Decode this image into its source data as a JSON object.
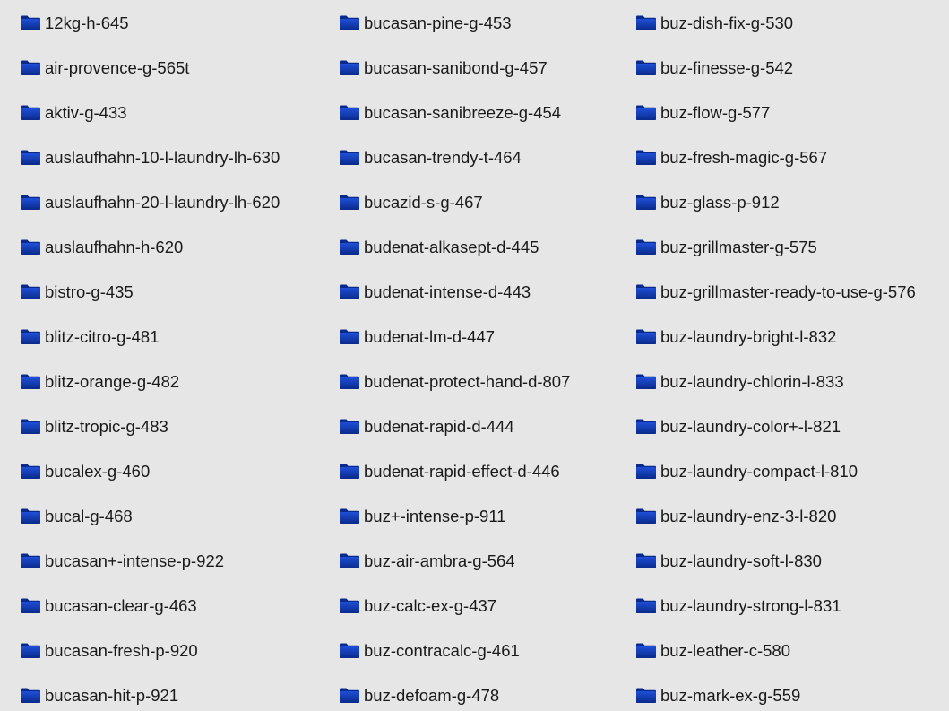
{
  "colors": {
    "background": "#e6e6e6",
    "text": "#1a1a1a",
    "folder_dark": "#0a2a8a",
    "folder_light": "#1f4fd8"
  },
  "folder_icon": "folder-icon",
  "columns": [
    {
      "items": [
        "12kg-h-645",
        "air-provence-g-565t",
        "aktiv-g-433",
        "auslaufhahn-10-l-laundry-lh-630",
        "auslaufhahn-20-l-laundry-lh-620",
        "auslaufhahn-h-620",
        "bistro-g-435",
        "blitz-citro-g-481",
        "blitz-orange-g-482",
        "blitz-tropic-g-483",
        "bucalex-g-460",
        "bucal-g-468",
        "bucasan+-intense-p-922",
        "bucasan-clear-g-463",
        "bucasan-fresh-p-920",
        "bucasan-hit-p-921"
      ]
    },
    {
      "items": [
        "bucasan-pine-g-453",
        "bucasan-sanibond-g-457",
        "bucasan-sanibreeze-g-454",
        "bucasan-trendy-t-464",
        "bucazid-s-g-467",
        "budenat-alkasept-d-445",
        "budenat-intense-d-443",
        "budenat-lm-d-447",
        "budenat-protect-hand-d-807",
        "budenat-rapid-d-444",
        "budenat-rapid-effect-d-446",
        "buz+-intense-p-911",
        "buz-air-ambra-g-564",
        "buz-calc-ex-g-437",
        "buz-contracalc-g-461",
        "buz-defoam-g-478"
      ]
    },
    {
      "items": [
        "buz-dish-fix-g-530",
        "buz-finesse-g-542",
        "buz-flow-g-577",
        "buz-fresh-magic-g-567",
        "buz-glass-p-912",
        "buz-grillmaster-g-575",
        "buz-grillmaster-ready-to-use-g-576",
        "buz-laundry-bright-l-832",
        "buz-laundry-chlorin-l-833",
        "buz-laundry-color+-l-821",
        "buz-laundry-compact-l-810",
        "buz-laundry-enz-3-l-820",
        "buz-laundry-soft-l-830",
        "buz-laundry-strong-l-831",
        "buz-leather-c-580",
        "buz-mark-ex-g-559"
      ]
    }
  ]
}
